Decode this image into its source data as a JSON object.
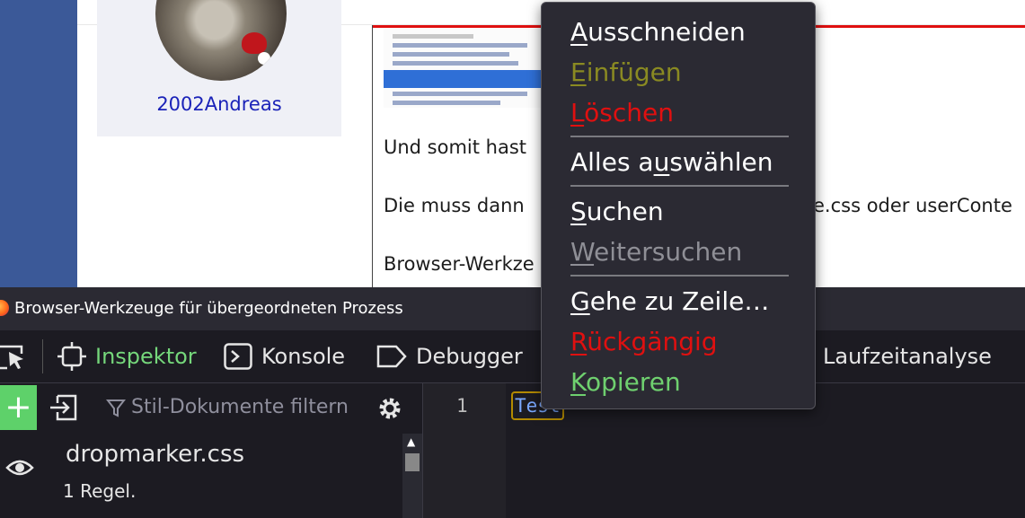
{
  "webpage": {
    "username": "2002Andreas",
    "post_lines": [
      "Und somit hast",
      "Die muss dann",
      "Browser-Werkze"
    ],
    "post_right_fragment": "e.css oder userConte"
  },
  "devtools": {
    "window_title": "Browser-Werkzeuge für übergeordneten Prozess",
    "tabs": [
      {
        "label": "Inspektor",
        "active": true
      },
      {
        "label": "Konsole",
        "active": false
      },
      {
        "label": "Debugger",
        "active": false
      },
      {
        "label": "Laufzeitanalyse",
        "active": false
      }
    ],
    "filter_placeholder": "Stil-Dokumente filtern",
    "stylesheet": {
      "name": "dropmarker.css",
      "rules": "1 Regel."
    },
    "editor": {
      "line_number": "1",
      "selected_text": "Test"
    }
  },
  "context_menu": {
    "items": [
      {
        "pre": "",
        "acc": "A",
        "post": "usschneiden",
        "state": "normal"
      },
      {
        "pre": "",
        "acc": "E",
        "post": "infügen",
        "state": "yellow"
      },
      {
        "pre": "",
        "acc": "L",
        "post": "öschen",
        "state": "red"
      },
      {
        "pre": "Alles a",
        "acc": "u",
        "post": "swählen",
        "state": "normal"
      },
      {
        "pre": "",
        "acc": "S",
        "post": "uchen",
        "state": "normal"
      },
      {
        "pre": "",
        "acc": "W",
        "post": "eitersuchen",
        "state": "disabled"
      },
      {
        "pre": "",
        "acc": "G",
        "post": "ehe zu Zeile…",
        "state": "normal"
      },
      {
        "pre": "",
        "acc": "R",
        "post": "ückgängig",
        "state": "red"
      },
      {
        "pre": "",
        "acc": "K",
        "post": "opieren",
        "state": "green"
      }
    ]
  },
  "colors": {
    "accent_green": "#75d77b",
    "menu_red": "#e01010",
    "menu_yellow": "#8a8a22",
    "username_blue": "#1a22b8"
  }
}
